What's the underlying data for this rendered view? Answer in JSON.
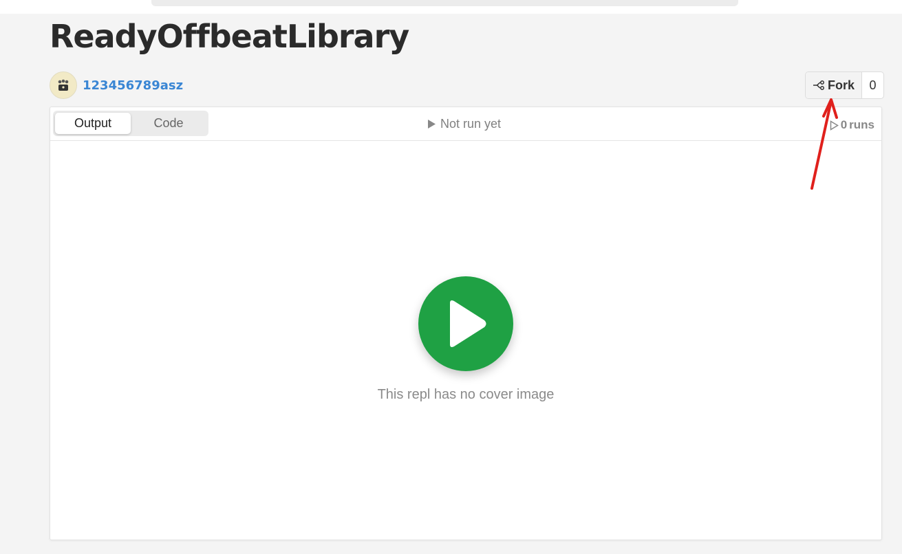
{
  "repl": {
    "title": "ReadyOffbeatLibrary",
    "author": "123456789asz"
  },
  "fork": {
    "label": "Fork",
    "count": "0"
  },
  "tabs": [
    {
      "label": "Output",
      "active": true
    },
    {
      "label": "Code",
      "active": false
    }
  ],
  "run_status": "Not run yet",
  "runs": {
    "count": "0",
    "label": "runs"
  },
  "cover": {
    "message": "This repl has no cover image"
  },
  "colors": {
    "accent_green": "#1fa144",
    "link_blue": "#3a86d4",
    "annotation_red": "#e0201c"
  },
  "icons": [
    "avatar-icon",
    "fork-icon",
    "play-triangle-icon",
    "play-outline-icon",
    "play-icon",
    "annotation-arrow"
  ]
}
